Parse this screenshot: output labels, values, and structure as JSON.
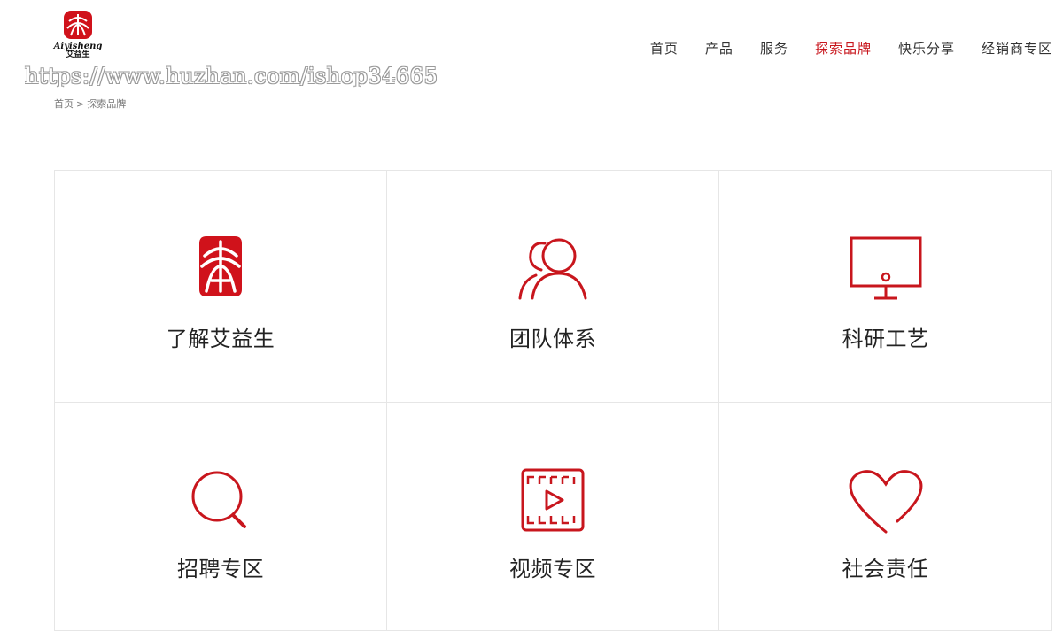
{
  "header": {
    "logo": {
      "brand_text": "Aiyisheng",
      "brand_cn": "艾益生"
    },
    "watermark": "https://www.huzhan.com/ishop34665",
    "nav": [
      {
        "label": "首页",
        "active": false
      },
      {
        "label": "产品",
        "active": false
      },
      {
        "label": "服务",
        "active": false
      },
      {
        "label": "探索品牌",
        "active": true
      },
      {
        "label": "快乐分享",
        "active": false
      },
      {
        "label": "经销商专区",
        "active": false
      }
    ]
  },
  "breadcrumb": {
    "home": "首页",
    "separator": ">",
    "current": "探索品牌"
  },
  "cards": [
    {
      "label": "了解艾益生",
      "icon": "brand-seal-icon"
    },
    {
      "label": "团队体系",
      "icon": "team-icon"
    },
    {
      "label": "科研工艺",
      "icon": "monitor-icon"
    },
    {
      "label": "招聘专区",
      "icon": "search-icon"
    },
    {
      "label": "视频专区",
      "icon": "video-icon"
    },
    {
      "label": "社会责任",
      "icon": "heart-icon"
    }
  ],
  "colors": {
    "accent": "#c8161d",
    "text": "#333333",
    "border": "#e6e6e6"
  }
}
